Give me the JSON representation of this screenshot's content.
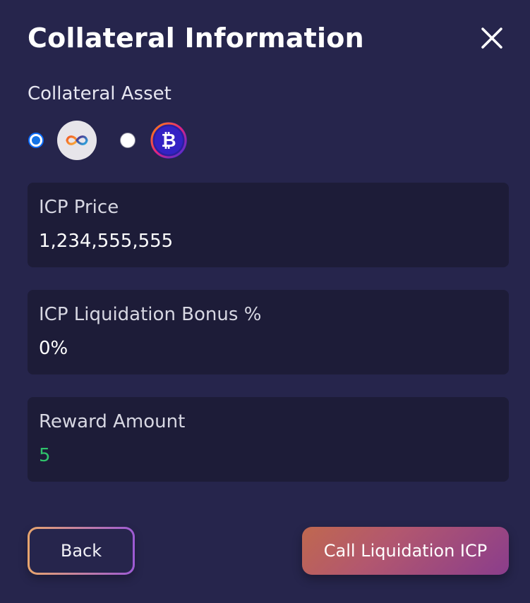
{
  "modal": {
    "title": "Collateral Information",
    "close_icon": "close-icon"
  },
  "collateral": {
    "label": "Collateral Asset",
    "options": [
      {
        "asset": "ICP",
        "icon": "icp-logo-icon",
        "selected": true
      },
      {
        "asset": "BTC",
        "icon": "bitcoin-logo-icon",
        "selected": false
      }
    ]
  },
  "cards": [
    {
      "label": "ICP Price",
      "value": "1,234,555,555"
    },
    {
      "label": "ICP Liquidation Bonus %",
      "value": "0%"
    },
    {
      "label": "Reward Amount",
      "value": "5"
    }
  ],
  "colors": {
    "background": "#26254c",
    "card": "#1d1c38",
    "reward_value": "#2fc36b",
    "radio_selected": "#1473e6"
  },
  "actions": {
    "back_label": "Back",
    "primary_label": "Call Liquidation ICP"
  }
}
